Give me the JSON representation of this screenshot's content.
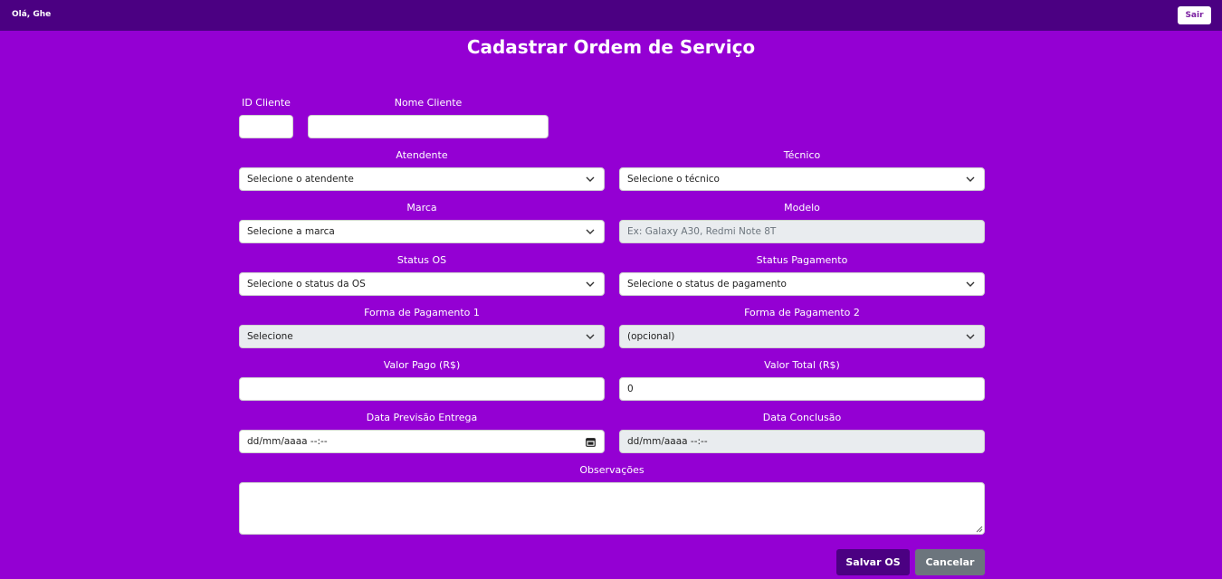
{
  "header": {
    "greeting": "Olá, Ghe",
    "logout_label": "Sair"
  },
  "page": {
    "title": "Cadastrar Ordem de Serviço"
  },
  "form": {
    "id_cliente": {
      "label": "ID Cliente",
      "value": ""
    },
    "nome_cliente": {
      "label": "Nome Cliente",
      "value": ""
    },
    "atendente": {
      "label": "Atendente",
      "selected": "Selecione o atendente"
    },
    "tecnico": {
      "label": "Técnico",
      "selected": "Selecione o técnico"
    },
    "marca": {
      "label": "Marca",
      "selected": "Selecione a marca"
    },
    "modelo": {
      "label": "Modelo",
      "placeholder": "Ex: Galaxy A30, Redmi Note 8T"
    },
    "status_os": {
      "label": "Status OS",
      "selected": "Selecione o status da OS"
    },
    "status_pagamento": {
      "label": "Status Pagamento",
      "selected": "Selecione o status de pagamento"
    },
    "forma_pagamento_1": {
      "label": "Forma de Pagamento 1",
      "selected": "Selecione"
    },
    "forma_pagamento_2": {
      "label": "Forma de Pagamento 2",
      "selected": "(opcional)"
    },
    "valor_pago": {
      "label": "Valor Pago (R$)",
      "value": ""
    },
    "valor_total": {
      "label": "Valor Total (R$)",
      "value": "0"
    },
    "data_previsao": {
      "label": "Data Previsão Entrega",
      "value": "dd/mm/aaaa --:--"
    },
    "data_conclusao": {
      "label": "Data Conclusão",
      "value": "dd/mm/aaaa --:--"
    },
    "observacoes": {
      "label": "Observações",
      "value": ""
    }
  },
  "actions": {
    "save_label": "Salvar OS",
    "cancel_label": "Cancelar"
  },
  "colors": {
    "background": "#9400d3",
    "header": "#4b0082",
    "save_button": "#4b0082",
    "cancel_button": "#6c757d",
    "disabled_field": "#e9ecef"
  },
  "icons": {
    "select": "chevron-down-icon",
    "date": "calendar-icon"
  }
}
